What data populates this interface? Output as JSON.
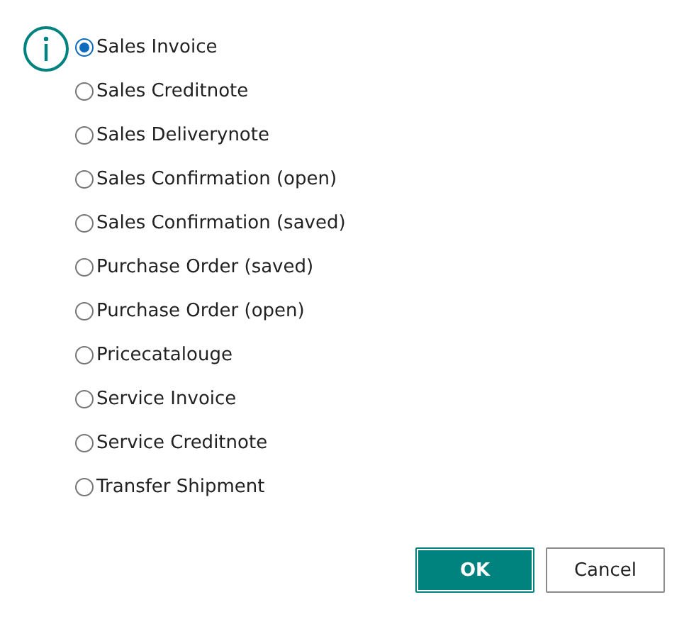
{
  "options": [
    {
      "label": "Sales Invoice",
      "selected": true
    },
    {
      "label": "Sales Creditnote",
      "selected": false
    },
    {
      "label": "Sales Deliverynote",
      "selected": false
    },
    {
      "label": "Sales Confirmation (open)",
      "selected": false
    },
    {
      "label": "Sales Confirmation (saved)",
      "selected": false
    },
    {
      "label": "Purchase Order (saved)",
      "selected": false
    },
    {
      "label": "Purchase Order (open)",
      "selected": false
    },
    {
      "label": "Pricecatalouge",
      "selected": false
    },
    {
      "label": "Service Invoice",
      "selected": false
    },
    {
      "label": "Service Creditnote",
      "selected": false
    },
    {
      "label": "Transfer Shipment",
      "selected": false
    }
  ],
  "buttons": [
    {
      "label": "OK",
      "kind": "primary"
    },
    {
      "label": "Cancel",
      "kind": "secondary"
    }
  ]
}
